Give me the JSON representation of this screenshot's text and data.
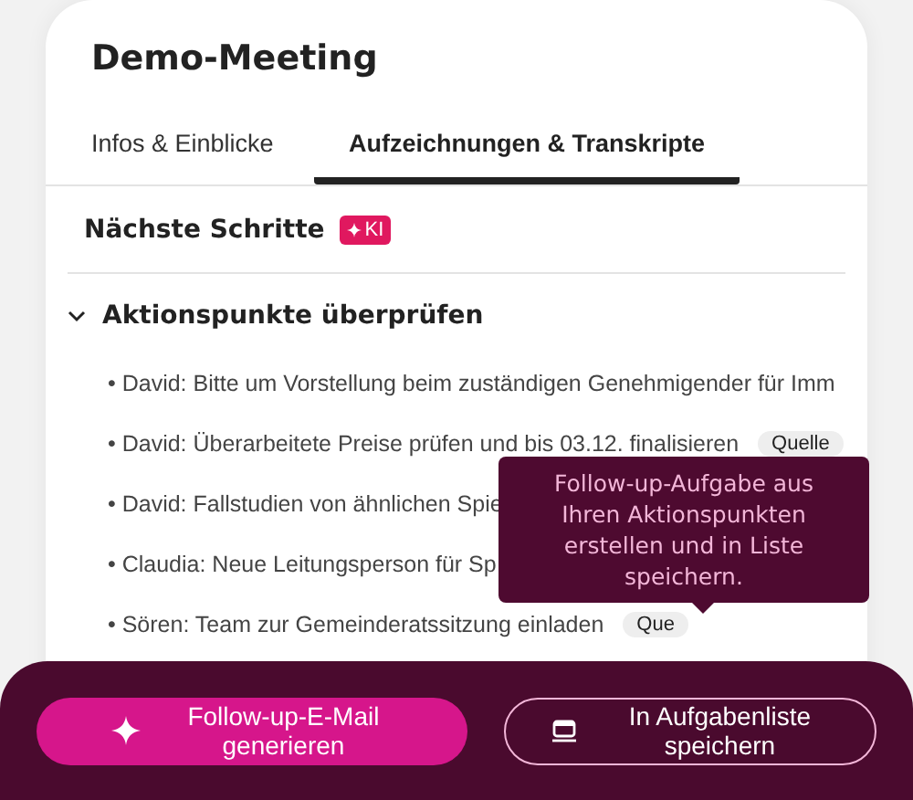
{
  "title": "Demo-Meeting",
  "tabs": [
    {
      "label": "Infos & Einblicke",
      "selected": false
    },
    {
      "label": "Aufzeichnungen & Transkripte",
      "selected": true
    }
  ],
  "next_steps": {
    "heading": "Nächste Schritte",
    "badge": "KI"
  },
  "section": {
    "title": "Aktionspunkte überprüfen",
    "expanded": true,
    "items": [
      {
        "text": "• David: Bitte um Vorstellung beim zuständigen Genehmigender für Imm"
      },
      {
        "text": "• David: Überarbeitete Preise prüfen und bis 03.12. finalisieren",
        "source": "Quelle"
      },
      {
        "text": "• David: Fallstudien von ähnlichen Spie"
      },
      {
        "text": "• Claudia: Neue Leitungsperson für Sp"
      },
      {
        "text": "• Sören: Team zur Gemeinderatssitzung einladen",
        "source": "Que"
      }
    ]
  },
  "tooltip": "Follow-up-Aufgabe aus Ihren Aktionspunkten erstellen und in Liste speichern.",
  "buttons": [
    {
      "kind": "primary",
      "label": "Follow-up-E-Mail generieren"
    },
    {
      "kind": "secondary",
      "label": "In Aufgabenliste speichern"
    }
  ]
}
